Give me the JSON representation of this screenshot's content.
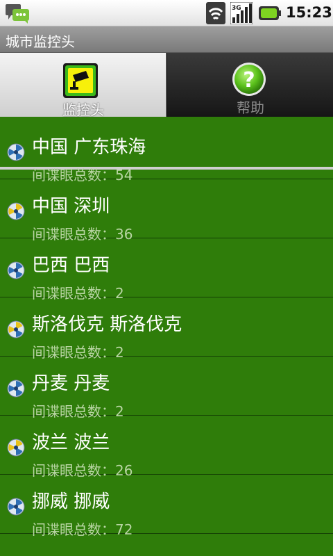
{
  "status_bar": {
    "time": "15:23",
    "icons": [
      "sms-notification-icon",
      "wifi-icon",
      "3g-signal-icon",
      "battery-icon"
    ],
    "signal_label": "3G"
  },
  "title_bar": {
    "title": "城市监控头"
  },
  "tabs": [
    {
      "label": "监控头",
      "icon": "camera-icon",
      "active": true
    },
    {
      "label": "帮助",
      "icon": "help-icon",
      "active": false
    }
  ],
  "colors": {
    "list_background": "#2f7d0a",
    "subtitle": "#b9d6a4"
  },
  "list": {
    "items": [
      {
        "title": "中国 广东珠海",
        "count_label": "间谍眼总数：",
        "count": "54",
        "icon": "radar-blue-icon"
      },
      {
        "title": "中国 深圳",
        "count_label": "间谍眼总数：",
        "count": "36",
        "icon": "radar-yellow-icon"
      },
      {
        "title": "巴西 巴西",
        "count_label": "间谍眼总数：",
        "count": "2",
        "icon": "radar-blue-icon"
      },
      {
        "title": "斯洛伐克 斯洛伐克",
        "count_label": "间谍眼总数：",
        "count": "2",
        "icon": "radar-yellow-icon"
      },
      {
        "title": "丹麦 丹麦",
        "count_label": "间谍眼总数：",
        "count": "2",
        "icon": "radar-blue-icon"
      },
      {
        "title": "波兰 波兰",
        "count_label": "间谍眼总数：",
        "count": "26",
        "icon": "radar-yellow-icon"
      },
      {
        "title": "挪威 挪威",
        "count_label": "间谍眼总数：",
        "count": "72",
        "icon": "radar-blue-icon"
      }
    ]
  }
}
